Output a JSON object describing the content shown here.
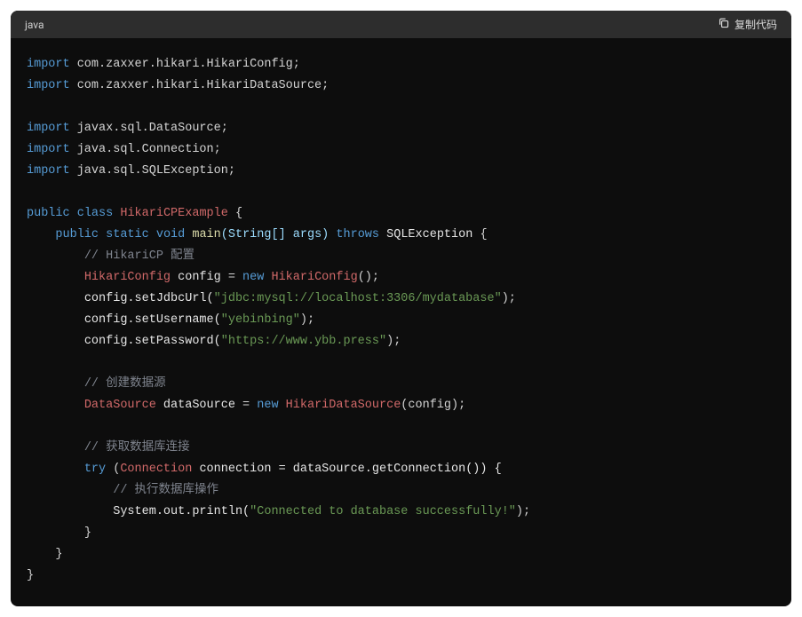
{
  "header": {
    "language": "java",
    "copy_label": "复制代码"
  },
  "code": {
    "import": "import",
    "pkg1": " com.zaxxer.hikari.HikariConfig;",
    "pkg2": " com.zaxxer.hikari.HikariDataSource;",
    "pkg3": " javax.sql.DataSource;",
    "pkg4": " java.sql.Connection;",
    "pkg5": " java.sql.SQLException;",
    "kw_public": "public",
    "kw_class": "class",
    "cls_main": "HikariCPExample",
    "brace_open": " {",
    "kw_static": "static",
    "kw_void": "void",
    "fn_main": "main",
    "params": "(String[] args)",
    "kw_throws": "throws",
    "ex_sql": "SQLException",
    "brace_open2": " {",
    "cm1": "// HikariCP 配置",
    "cls_cfg": "HikariConfig",
    "var_cfg": " config ",
    "eq": "= ",
    "kw_new": "new",
    "cls_cfg2": "HikariConfig",
    "empty_call": "();",
    "stmt_url_pre": "config.setJdbcUrl(",
    "str_url": "\"jdbc:mysql://localhost:3306/mydatabase\"",
    "stmt_url_post": ");",
    "stmt_user_pre": "config.setUsername(",
    "str_user": "\"yebinbing\"",
    "stmt_user_post": ");",
    "stmt_pass_pre": "config.setPassword(",
    "str_pass": "\"https://www.ybb.press\"",
    "stmt_pass_post": ");",
    "cm2": "// 创建数据源",
    "cls_ds": "DataSource",
    "var_ds": " dataSource ",
    "cls_hds": "HikariDataSource",
    "hds_arg": "(config);",
    "cm3": "// 获取数据库连接",
    "kw_try": "try",
    "try_open": " (",
    "cls_conn": "Connection",
    "var_conn": " connection ",
    "getconn": "= dataSource.getConnection()) {",
    "cm4": "// 执行数据库操作",
    "stmt_print_pre": "System.out.println(",
    "str_print": "\"Connected to database successfully!\"",
    "stmt_print_post": ");",
    "brace_close": "}",
    "indent1": "    ",
    "indent2": "        ",
    "indent3": "            "
  }
}
